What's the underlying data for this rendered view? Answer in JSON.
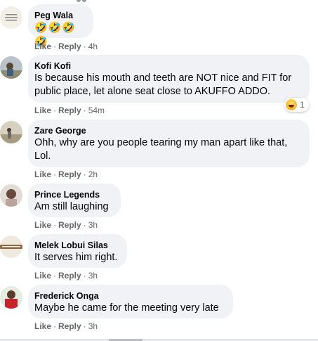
{
  "comments": [
    {
      "author": "Peg Wala",
      "text": "🤣🤣🤣🤣",
      "like": "Like",
      "reply": "Reply",
      "time": "4h"
    },
    {
      "author": "Kofi Kofi",
      "text": "Is because his mouth and teeth are NOT nice and FIT for public place, let alone seat close to AKUFFO ADDO.",
      "like": "Like",
      "reply": "Reply",
      "time": "54m",
      "reaction_count": "1"
    },
    {
      "author": "Zare George",
      "text": "Ohh, why are you people tearing my man apart like that, Lol.",
      "like": "Like",
      "reply": "Reply",
      "time": "2h"
    },
    {
      "author": "Prince Legends",
      "text": "Am still laughing",
      "like": "Like",
      "reply": "Reply",
      "time": "3h"
    },
    {
      "author": "Melek Lobui Silas",
      "text": "It serves him right.",
      "like": "Like",
      "reply": "Reply",
      "time": "3h"
    },
    {
      "author": "Frederick Onga",
      "text": "Maybe he came for the meeting very late",
      "like": "Like",
      "reply": "Reply",
      "time": "3h"
    }
  ],
  "avatar_icons": [
    "avatar-text-icon",
    "avatar-person-icon",
    "avatar-person-icon",
    "avatar-person-icon",
    "avatar-logo-icon",
    "avatar-person-icon"
  ],
  "colors": {
    "bubble": "#f0f2f5",
    "meta": "#65676b",
    "text": "#050505"
  }
}
